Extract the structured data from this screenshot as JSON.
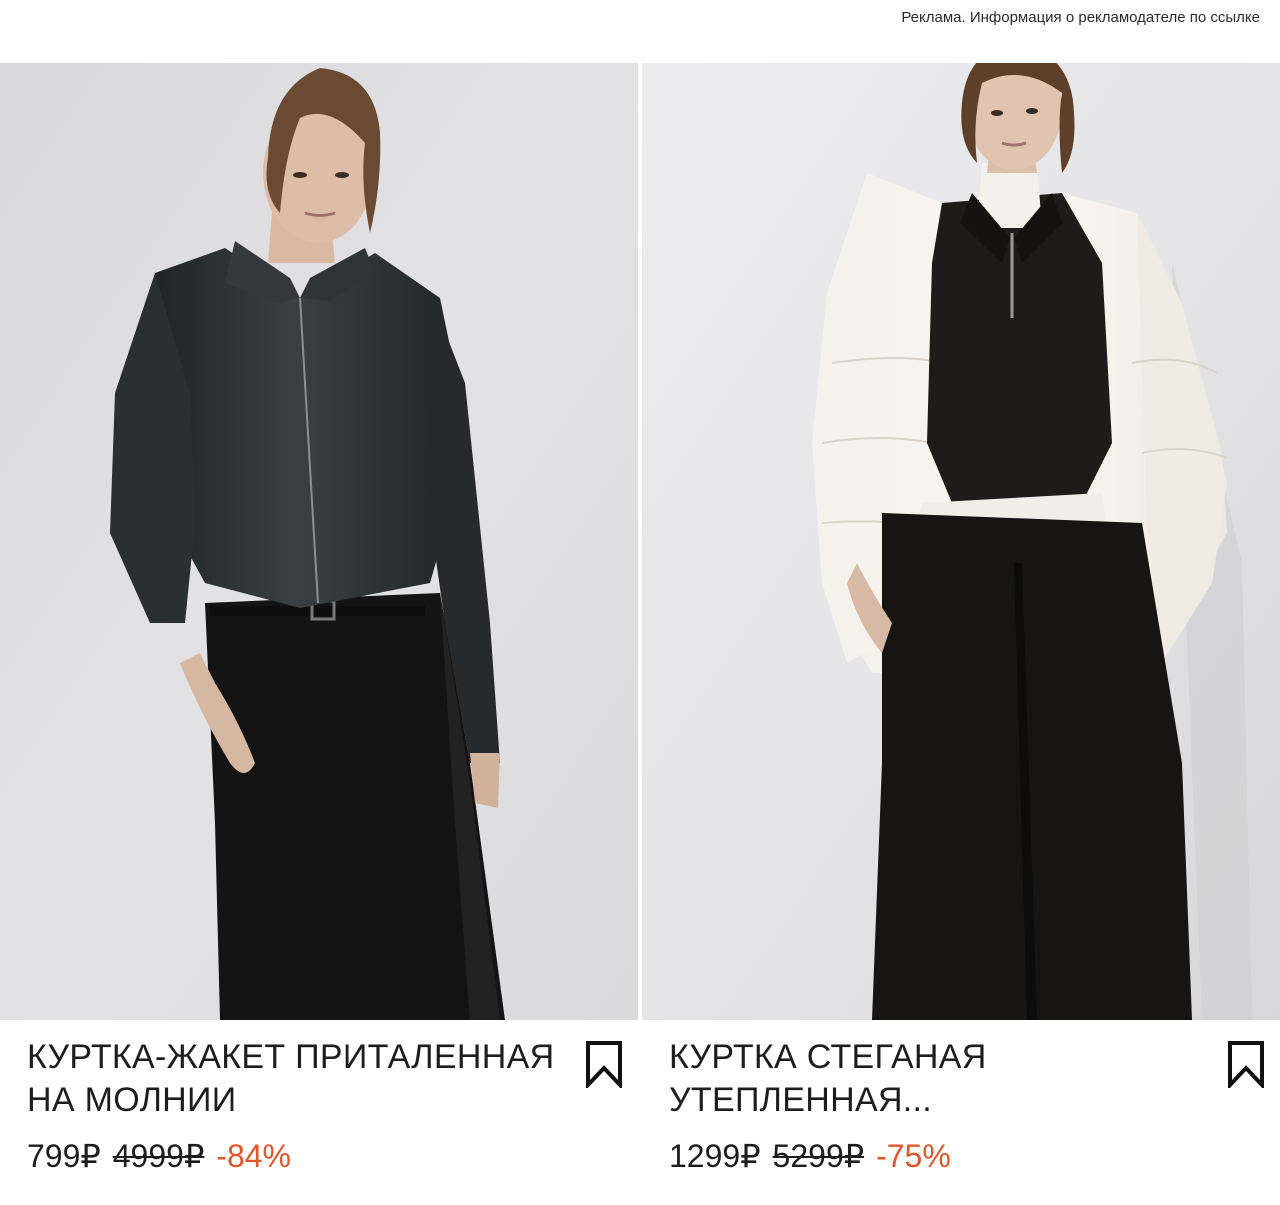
{
  "ad_notice": "Реклама. Информация о рекламодателе по ссылке",
  "products": [
    {
      "title": "КУРТКА-ЖАКЕТ ПРИТАЛЕННАЯ НА МОЛНИИ",
      "price_current": "799₽",
      "price_old": "4999₽",
      "discount": "-84%",
      "bookmark_icon": "bookmark-icon"
    },
    {
      "title": "КУРТКА СТЕГАНАЯ УТЕПЛЕННАЯ...",
      "price_current": "1299₽",
      "price_old": "5299₽",
      "discount": "-75%",
      "bookmark_icon": "bookmark-icon"
    }
  ],
  "colors": {
    "discount": "#e0562b",
    "text": "#1d1d1d",
    "photo_background": "#e4e4e6"
  }
}
